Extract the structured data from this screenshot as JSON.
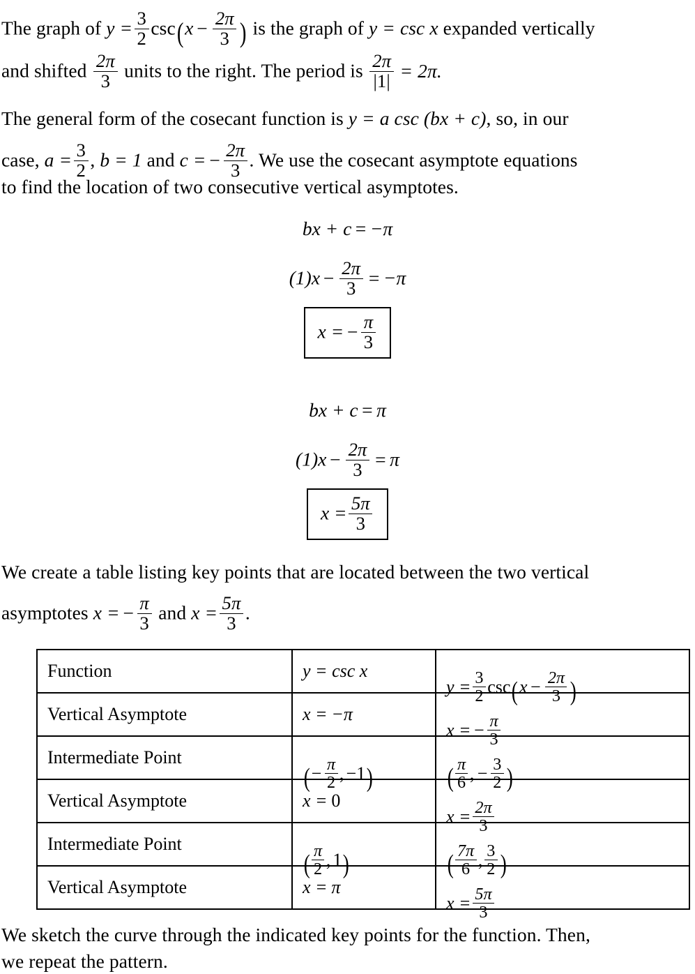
{
  "document": {
    "type": "math-solution-worked-example",
    "topic": "Graphing y = (3/2)csc(x - 2pi/3)"
  },
  "paragraph1": {
    "text_plain": "The graph of y = 3/2 csc (x - 2pi/3) is the graph of y = csc x expanded vertically and shifted 2pi/3 units to the right. The period is 2pi/|1| = 2pi.",
    "seg_a": "The graph of ",
    "seg_b": " is the graph of ",
    "seg_c": " expanded vertically",
    "seg_d": "and shifted ",
    "seg_e": " units to the right.  The period is ",
    "eq_graph_of_y": "y =",
    "amplitude_num": "3",
    "amplitude_den": "2",
    "csc_op": "csc",
    "var_x": "x",
    "minus": "−",
    "shift_num": "2π",
    "shift_den": "3",
    "base_fn": "y = csc x",
    "period_num": "2π",
    "period_den": "|1|",
    "period_value": "= 2π."
  },
  "paragraph2": {
    "text_plain": "The general form of the cosecant function is y = a csc (bx + c), so, in our case, a = 3/2, b = 1 and c = -2pi/3. We use the cosecant asymptote equations to find the location of two consecutive vertical asymptotes.",
    "seg_a": "The general form of the cosecant function is ",
    "general_form": "y = a csc (bx + c)",
    "seg_b": ", so, in our",
    "seg_c": "case, ",
    "a_label": "a =",
    "a_num": "3",
    "a_den": "2",
    "seg_d": ", ",
    "b_statement": "b = 1",
    "seg_e": " and ",
    "c_label": "c =",
    "c_num": "2π",
    "c_den": "3",
    "seg_f": ". We use the cosecant asymptote equations",
    "seg_g": "to find the location of two consecutive vertical asymptotes."
  },
  "equation_block_1": {
    "line1": "bx + c = −π",
    "line1_lhs": "bx + c",
    "line1_rhs": "−π",
    "line2_prefix": "(1)x",
    "line2_minus": "−",
    "line2_num": "2π",
    "line2_den": "3",
    "line2_rhs": "−π",
    "boxed_lhs": "x =",
    "boxed_sign": "−",
    "boxed_num": "π",
    "boxed_den": "3",
    "boxed_plain": "x = -pi/3"
  },
  "equation_block_2": {
    "line1": "bx + c = π",
    "line1_lhs": "bx + c",
    "line1_rhs": "π",
    "line2_prefix": "(1)x",
    "line2_minus": "−",
    "line2_num": "2π",
    "line2_den": "3",
    "line2_rhs": "π",
    "boxed_lhs": "x =",
    "boxed_num": "5π",
    "boxed_den": "3",
    "boxed_plain": "x = 5pi/3"
  },
  "paragraph3": {
    "text_plain": "We create a table listing key points that are located between the two vertical asymptotes x = -pi/3 and x = 5pi/3.",
    "seg_a": "We create a table listing key points that are located between the two vertical",
    "seg_b": "asymptotes ",
    "asym1_lhs": "x =",
    "asym1_sign": "−",
    "asym1_num": "π",
    "asym1_den": "3",
    "seg_c": " and ",
    "asym2_lhs": "x =",
    "asym2_num": "5π",
    "asym2_den": "3",
    "seg_d": "."
  },
  "table": {
    "columns": [
      "Function",
      "y = csc x",
      "y = 3/2 csc (x - 2pi/3)"
    ],
    "rows": [
      {
        "label": "Function",
        "col2_plain": "y = csc x",
        "col3_plain": "y = 3/2 csc (x - 2pi/3)",
        "type": "header"
      },
      {
        "label": "Vertical Asymptote",
        "col2_plain": "x = -π",
        "col3_plain": "x = -π/3",
        "type": "asymptote",
        "col3_num": "π",
        "col3_den": "3",
        "col3_sign": "−"
      },
      {
        "label": "Intermediate Point",
        "col2_plain": "(-π/2, -1)",
        "col3_plain": "(π/6, -3/2)",
        "type": "point",
        "col2_x_num": "π",
        "col2_x_den": "2",
        "col2_y": "−1",
        "col3_x_num": "π",
        "col3_x_den": "6",
        "col3_y_num": "3",
        "col3_y_den": "2"
      },
      {
        "label": "Vertical Asymptote",
        "col2_plain": "x = 0",
        "col3_plain": "x = 2π/3",
        "type": "asymptote",
        "col3_num": "2π",
        "col3_den": "3"
      },
      {
        "label": "Intermediate Point",
        "col2_plain": "(π/2, 1)",
        "col3_plain": "(7π/6, 3/2)",
        "type": "point",
        "col2_x_num": "π",
        "col2_x_den": "2",
        "col2_y": "1",
        "col3_x_num": "7π",
        "col3_x_den": "6",
        "col3_y_num": "3",
        "col3_y_den": "2"
      },
      {
        "label": "Vertical Asymptote",
        "col2_plain": "x = π",
        "col3_plain": "x = 5π/3",
        "type": "asymptote",
        "col3_num": "5π",
        "col3_den": "3"
      }
    ],
    "labels": {
      "function": "Function",
      "vertical_asymptote": "Vertical Asymptote",
      "intermediate_point": "Intermediate Point"
    },
    "col2": {
      "r0": "y = csc x",
      "r1_lhs": "x =",
      "r1_val": "−π",
      "r3_lhs": "x =",
      "r3_val": "0",
      "r5_lhs": "x =",
      "r5_val": "π"
    },
    "col3": {
      "r0_lhs": "y =",
      "r0_num": "3",
      "r0_den": "2",
      "r0_csc": "csc",
      "r0_var": "x",
      "r0_minus": "−",
      "r0_shift_num": "2π",
      "r0_shift_den": "3"
    }
  },
  "paragraph4": {
    "text_plain": "We sketch the curve through the indicated key points for the function.  Then, we repeat the pattern.",
    "seg_a": "We sketch the curve through the indicated key points for the function.  Then,",
    "seg_b": "we repeat the pattern."
  },
  "style": {
    "text_color": "#000000",
    "background": "#ffffff",
    "rule_color": "#000000"
  }
}
